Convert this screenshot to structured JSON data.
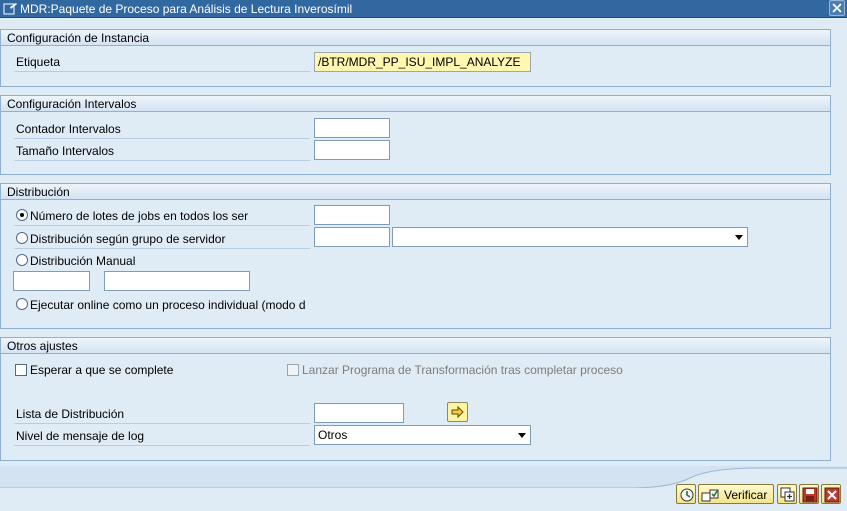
{
  "window": {
    "title": "MDR:Paquete de Proceso para Análisis de Lectura Inverosímil"
  },
  "instancia": {
    "title": "Configuración de Instancia",
    "etiqueta_label": "Etiqueta",
    "etiqueta_value": "/BTR/MDR_PP_ISU_IMPL_ANALYZE"
  },
  "intervalos": {
    "title": "Configuración Intervalos",
    "contador_label": "Contador Intervalos",
    "contador_value": "",
    "tamano_label": "Tamaño Intervalos",
    "tamano_value": ""
  },
  "distribucion": {
    "title": "Distribución",
    "options": [
      {
        "label": "Número de lotes de jobs en todos los ser",
        "selected": true
      },
      {
        "label": "Distribución según grupo de servidor",
        "selected": false
      },
      {
        "label": "Distribución Manual",
        "selected": false
      },
      {
        "label": "Ejecutar online como un proceso individual (modo d",
        "selected": false
      }
    ],
    "lotes_value": "",
    "grupo_value": "",
    "grupo_select": "",
    "manual_value_1": "",
    "manual_value_2": ""
  },
  "otros": {
    "title": "Otros ajustes",
    "esperar_label": "Esperar a que se complete",
    "esperar_checked": false,
    "lanzar_label": "Lanzar Programa de Transformación tras completar proceso",
    "lanzar_checked": false,
    "lanzar_enabled": false,
    "lista_label": "Lista de Distribución",
    "lista_value": "",
    "nivel_label": "Nivel de mensaje de log",
    "nivel_value": "Otros"
  },
  "toolbar": {
    "verificar_label": "Verificar"
  },
  "icons": {
    "title_icon": "window-edit-icon",
    "close": "close-icon",
    "execute": "execute-icon",
    "verificar": "check-icon",
    "copy": "copy-icon",
    "save": "save-icon",
    "cancel": "cancel-icon",
    "lista_arrow": "arrow-right-icon"
  },
  "colors": {
    "titlebar": "#3268a0",
    "background": "#dfebf5",
    "readonly_field": "#fff6b0",
    "cancel": "#c0392b"
  }
}
